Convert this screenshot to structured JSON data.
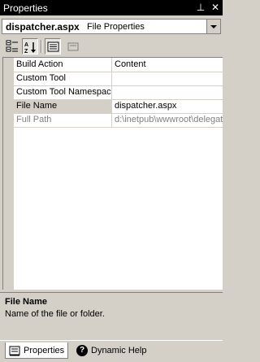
{
  "window": {
    "title": "Properties",
    "pin_glyph": "⊥",
    "close_glyph": "✕"
  },
  "object_selector": {
    "name": "dispatcher.aspx",
    "type": "File Properties"
  },
  "toolbar": {
    "categorized_icon": "categorized-icon",
    "alphabetical_icon": "alphabetical-icon",
    "properties_icon": "properties-icon",
    "property_pages_icon": "property-pages-icon"
  },
  "properties": [
    {
      "name": "Build Action",
      "value": "Content"
    },
    {
      "name": "Custom Tool",
      "value": ""
    },
    {
      "name": "Custom Tool Namespace",
      "value": ""
    },
    {
      "name": "File Name",
      "value": "dispatcher.aspx"
    },
    {
      "name": "Full Path",
      "value": "d:\\inetpub\\wwwroot\\delegat"
    }
  ],
  "description": {
    "title": "File Name",
    "text": "Name of the file or folder."
  },
  "tabs": [
    {
      "label": "Properties"
    },
    {
      "label": "Dynamic Help"
    }
  ]
}
